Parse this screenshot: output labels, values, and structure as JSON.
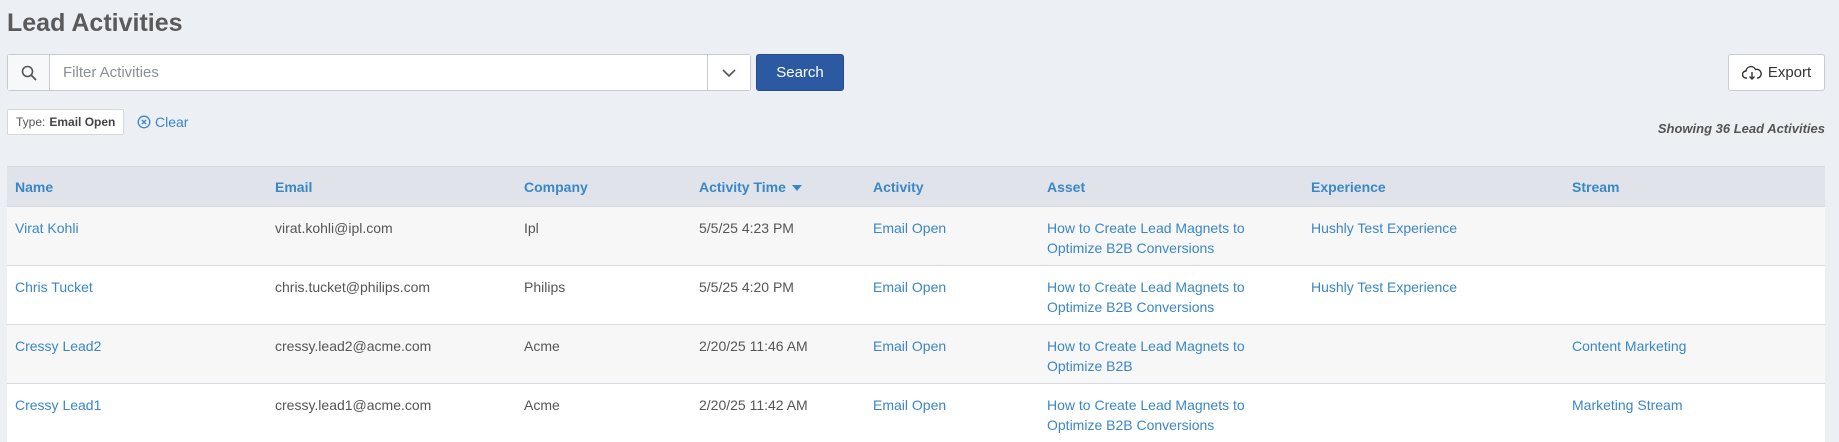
{
  "page_title": "Lead Activities",
  "search": {
    "placeholder": "Filter Activities",
    "value": "",
    "button_label": "Search"
  },
  "export_label": "Export",
  "filter": {
    "type_label": "Type:",
    "type_value": "Email Open",
    "clear_label": "Clear"
  },
  "showing_text": "Showing 36 Lead Activities",
  "table": {
    "columns": [
      "Name",
      "Email",
      "Company",
      "Activity Time",
      "Activity",
      "Asset",
      "Experience",
      "Stream"
    ],
    "sorted_column": "Activity Time",
    "rows": [
      {
        "name": "Virat Kohli",
        "email": "virat.kohli@ipl.com",
        "company": "Ipl",
        "time": "5/5/25 4:23 PM",
        "activity": "Email Open",
        "asset": "How to Create Lead Magnets to Optimize B2B Conversions",
        "experience": "Hushly Test Experience",
        "stream": ""
      },
      {
        "name": "Chris Tucket",
        "email": "chris.tucket@philips.com",
        "company": "Philips",
        "time": "5/5/25 4:20 PM",
        "activity": "Email Open",
        "asset": "How to Create Lead Magnets to Optimize B2B Conversions",
        "experience": "Hushly Test Experience",
        "stream": ""
      },
      {
        "name": "Cressy Lead2",
        "email": "cressy.lead2@acme.com",
        "company": "Acme",
        "time": "2/20/25 11:46 AM",
        "activity": "Email Open",
        "asset": "How to Create Lead Magnets to Optimize B2B",
        "experience": "",
        "stream": "Content Marketing"
      },
      {
        "name": "Cressy Lead1",
        "email": "cressy.lead1@acme.com",
        "company": "Acme",
        "time": "2/20/25 11:42 AM",
        "activity": "Email Open",
        "asset": "How to Create Lead Magnets to Optimize B2B Conversions",
        "experience": "",
        "stream": "Marketing Stream"
      }
    ]
  },
  "colors": {
    "accent": "#2b5aa3",
    "link": "#3a87c7",
    "background": "#eceff4"
  },
  "icons": {
    "search": "search-icon",
    "dropdown": "chevron-down-icon",
    "export": "cloud-download-icon",
    "clear": "close-circle-icon"
  }
}
